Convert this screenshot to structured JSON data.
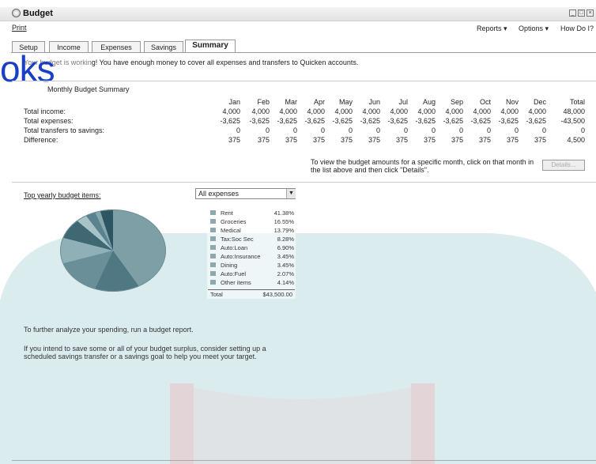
{
  "window": {
    "title": "Budget"
  },
  "menu": {
    "print": "Print",
    "reports": "Reports ▾",
    "options": "Options ▾",
    "how_do_i": "How Do I?"
  },
  "tabs": [
    {
      "label": "Setup"
    },
    {
      "label": "Income"
    },
    {
      "label": "Expenses"
    },
    {
      "label": "Savings"
    },
    {
      "label": "Summary"
    }
  ],
  "message": "Your budget is working! You have enough money to cover all expenses and transfers to Quicken accounts.",
  "watermark": "oks",
  "summary": {
    "title": "Monthly Budget Summary",
    "months": [
      "Jan",
      "Feb",
      "Mar",
      "Apr",
      "May",
      "Jun",
      "Jul",
      "Aug",
      "Sep",
      "Oct",
      "Nov",
      "Dec",
      "Total"
    ],
    "rows": [
      {
        "label": "Total income:",
        "values": [
          "4,000",
          "4,000",
          "4,000",
          "4,000",
          "4,000",
          "4,000",
          "4,000",
          "4,000",
          "4,000",
          "4,000",
          "4,000",
          "4,000",
          "48,000"
        ]
      },
      {
        "label": "Total expenses:",
        "values": [
          "-3,625",
          "-3,625",
          "-3,625",
          "-3,625",
          "-3,625",
          "-3,625",
          "-3,625",
          "-3,625",
          "-3,625",
          "-3,625",
          "-3,625",
          "-3,625",
          "-43,500"
        ]
      },
      {
        "label": "Total transfers to savings:",
        "values": [
          "0",
          "0",
          "0",
          "0",
          "0",
          "0",
          "0",
          "0",
          "0",
          "0",
          "0",
          "0",
          "0"
        ]
      },
      {
        "label": "Difference:",
        "values": [
          "375",
          "375",
          "375",
          "375",
          "375",
          "375",
          "375",
          "375",
          "375",
          "375",
          "375",
          "375",
          "4,500"
        ]
      }
    ],
    "hint": "To view the budget amounts for a specific month, click on that month in the list above and then click \"Details\".",
    "details_button": "Details..."
  },
  "top_items": {
    "label": "Top yearly budget items:",
    "select_value": "All expenses",
    "items": [
      {
        "name": "Rent",
        "pct": "41.38%"
      },
      {
        "name": "Groceries",
        "pct": "16.55%"
      },
      {
        "name": "Medical",
        "pct": "13.79%"
      },
      {
        "name": "Tax:Soc Sec",
        "pct": "8.28%"
      },
      {
        "name": "Auto:Loan",
        "pct": "6.90%"
      },
      {
        "name": "Auto:Insurance",
        "pct": "3.45%"
      },
      {
        "name": "Dining",
        "pct": "3.45%"
      },
      {
        "name": "Auto:Fuel",
        "pct": "2.07%"
      },
      {
        "name": "Other items",
        "pct": "4.14%"
      }
    ],
    "total_label": "Total",
    "total_value": "$43,500.00"
  },
  "advice": [
    "To further analyze your spending, run a budget report.",
    "If you intend to save some or all of your budget surplus, consider setting up a",
    "scheduled savings transfer or a savings goal to help you meet your target."
  ],
  "colors": {
    "tab_border": "#999999",
    "pie_base": "#7f9fa6",
    "link_blue": "#1a3fc4",
    "bg_tint": "#cfe5ea"
  }
}
